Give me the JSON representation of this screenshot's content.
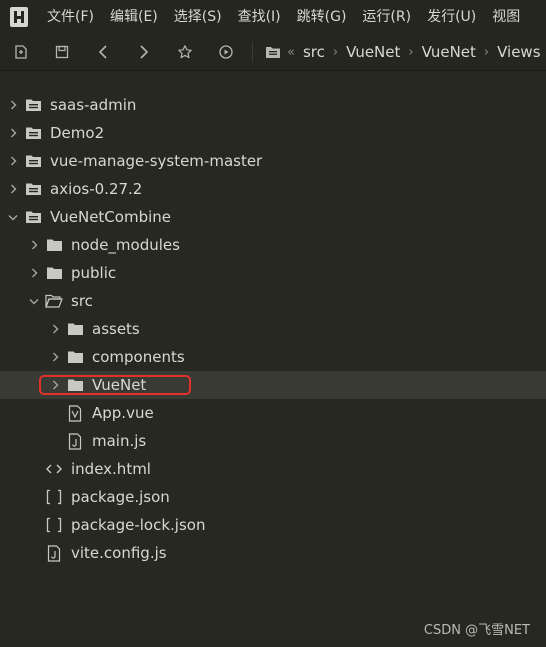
{
  "menu": [
    "文件(F)",
    "编辑(E)",
    "选择(S)",
    "查找(I)",
    "跳转(G)",
    "运行(R)",
    "发行(U)",
    "视图"
  ],
  "toolbar": {
    "icons": [
      "new-file-icon",
      "save-icon",
      "back-icon",
      "forward-icon",
      "star-icon",
      "run-icon"
    ],
    "breadcrumb": {
      "root_icon": "folder-icon",
      "separator": "«",
      "items": [
        "src",
        "VueNet",
        "VueNet",
        "Views"
      ],
      "item_separator": "›"
    }
  },
  "tree": {
    "saas_admin": "saas-admin",
    "demo2": "Demo2",
    "vue_manage": "vue-manage-system-master",
    "axios": "axios-0.27.2",
    "vuenetcombine": "VueNetCombine",
    "node_modules": "node_modules",
    "public": "public",
    "src": "src",
    "assets": "assets",
    "components": "components",
    "vuenet": "VueNet",
    "app_vue": "App.vue",
    "main_js": "main.js",
    "index_html": "index.html",
    "package_json": "package.json",
    "package_lock": "package-lock.json",
    "vite_config": "vite.config.js"
  },
  "colors": {
    "background": "#272822",
    "highlight_border": "#e0322b",
    "text": "#d8d8d3"
  },
  "watermark": "CSDN @飞雪NET"
}
